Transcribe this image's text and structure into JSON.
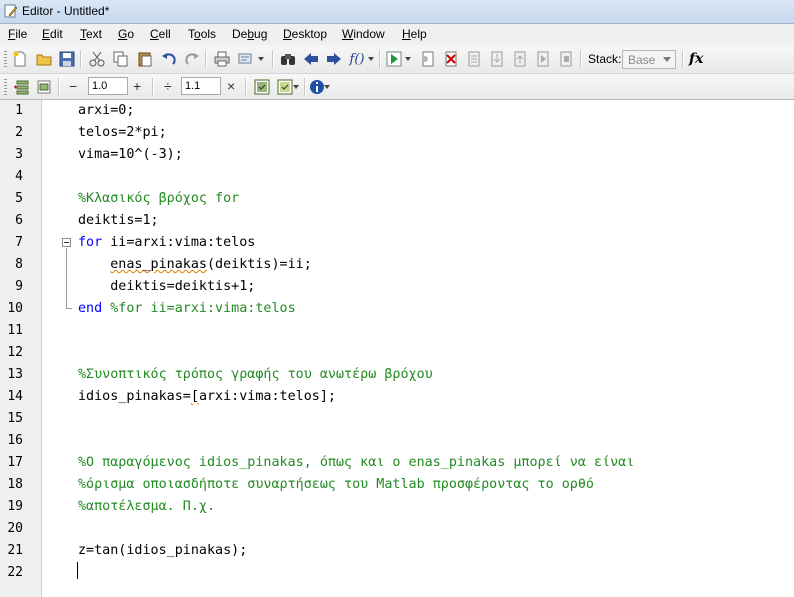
{
  "window": {
    "title": "Editor - Untitled*"
  },
  "menu": [
    {
      "label": "File",
      "u": "F",
      "rest": "ile"
    },
    {
      "label": "Edit",
      "u": "E",
      "rest": "dit"
    },
    {
      "label": "Text",
      "u": "T",
      "rest": "ext"
    },
    {
      "label": "Go",
      "u": "G",
      "rest": "o"
    },
    {
      "label": "Cell",
      "u": "C",
      "rest": "ell"
    },
    {
      "label": "Tools",
      "pre": "T",
      "u": "o",
      "rest": "ols"
    },
    {
      "label": "Debug",
      "pre": "De",
      "u": "b",
      "rest": "ug"
    },
    {
      "label": "Desktop",
      "u": "D",
      "rest": "esktop"
    },
    {
      "label": "Window",
      "u": "W",
      "rest": "indow"
    },
    {
      "label": "Help",
      "u": "H",
      "rest": "elp"
    }
  ],
  "toolbar": {
    "stack_label": "Stack:",
    "stack_value": "Base",
    "fx_label": "fx"
  },
  "cell_toolbar": {
    "minus": "−",
    "value1": "1.0",
    "plus": "+",
    "divide": "÷",
    "value2": "1.1",
    "times": "×"
  },
  "editor": {
    "line_numbers": [
      "1",
      "2",
      "3",
      "4",
      "5",
      "6",
      "7",
      "8",
      "9",
      "10",
      "11",
      "12",
      "13",
      "14",
      "15",
      "16",
      "17",
      "18",
      "19",
      "20",
      "21",
      "22"
    ],
    "lines": [
      "arxi=0;",
      "telos=2*pi;",
      "vima=10^(-3);",
      "",
      "%Κλασικός βρόχος for",
      "deiktis=1;",
      "for ii=arxi:vima:telos",
      "    enas_pinakas(deiktis)=ii;",
      "    deiktis=deiktis+1;",
      "end %for ii=arxi:vima:telos",
      "",
      "",
      "%Συνοπτικός τρόπος γραφής του ανωτέρω βρόχου",
      "idios_pinakas=[arxi:vima:telos];",
      "",
      "",
      "%Ο παραγόμενος idios_pinakas, όπως και ο enas_pinakas μπορεί να είναι",
      "%όρισμα οποιασδήποτε συναρτήσεως του Matlab προσφέροντας το ορθό",
      "%αποτέλεσμα. Π.χ.",
      "",
      "z=tan(idios_pinakas);",
      ""
    ],
    "colors": {
      "keyword": "#0000ff",
      "comment": "#228b22",
      "text": "#000000"
    }
  }
}
